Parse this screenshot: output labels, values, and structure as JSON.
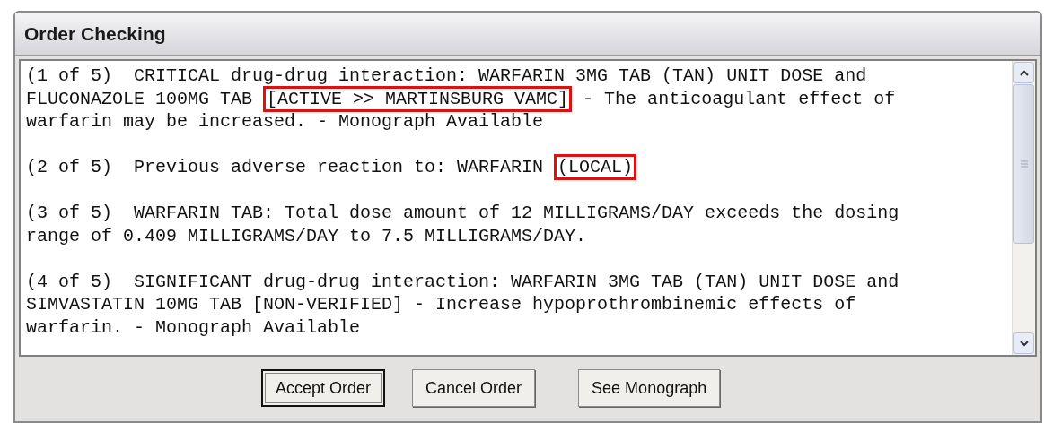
{
  "window": {
    "title": "Order Checking"
  },
  "messages": [
    {
      "lines": [
        [
          {
            "text": "(1 of 5)  CRITICAL drug-drug interaction: WARFARIN 3MG TAB (TAN) UNIT DOSE and",
            "highlighted": false
          }
        ],
        [
          {
            "text": "FLUCONAZOLE 100MG TAB ",
            "highlighted": false
          },
          {
            "text": "[ACTIVE >> MARTINSBURG VAMC]",
            "highlighted": true
          },
          {
            "text": " - The anticoagulant effect of",
            "highlighted": false
          }
        ],
        [
          {
            "text": "warfarin may be increased. - Monograph Available",
            "highlighted": false
          }
        ]
      ]
    },
    {
      "lines": [
        [
          {
            "text": "(2 of 5)  Previous adverse reaction to: WARFARIN ",
            "highlighted": false
          },
          {
            "text": "(LOCAL)",
            "highlighted": true
          }
        ]
      ]
    },
    {
      "lines": [
        [
          {
            "text": "(3 of 5)  WARFARIN TAB: Total dose amount of 12 MILLIGRAMS/DAY exceeds the dosing",
            "highlighted": false
          }
        ],
        [
          {
            "text": "range of 0.409 MILLIGRAMS/DAY to 7.5 MILLIGRAMS/DAY.",
            "highlighted": false
          }
        ]
      ]
    },
    {
      "lines": [
        [
          {
            "text": "(4 of 5)  SIGNIFICANT drug-drug interaction: WARFARIN 3MG TAB (TAN) UNIT DOSE and",
            "highlighted": false
          }
        ],
        [
          {
            "text": "SIMVASTATIN 10MG TAB [NON-VERIFIED] - Increase hypoprothrombinemic effects of",
            "highlighted": false
          }
        ],
        [
          {
            "text": "warfarin. - Monograph Available",
            "highlighted": false
          }
        ]
      ]
    }
  ],
  "buttons": [
    {
      "label": "Accept Order",
      "selected": true
    },
    {
      "label": "Cancel Order",
      "selected": false
    },
    {
      "label": "See Monograph",
      "selected": false
    }
  ]
}
